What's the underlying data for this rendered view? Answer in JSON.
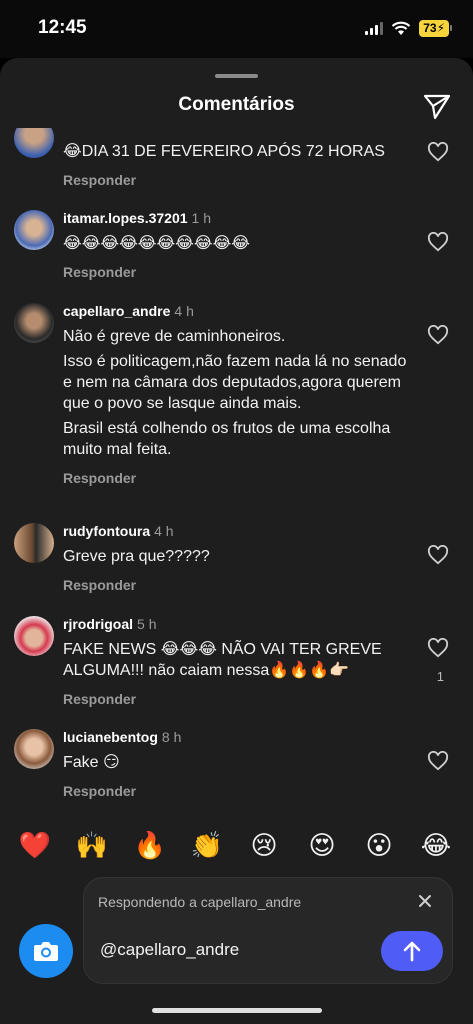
{
  "status_bar": {
    "time": "12:45",
    "battery": "73"
  },
  "sheet": {
    "title": "Comentários"
  },
  "reply_label": "Responder",
  "comments": [
    {
      "user": "",
      "time": "",
      "lines": [
        "😂DIA 31 DE FEVEREIRO APÓS 72 HORAS"
      ],
      "likes": ""
    },
    {
      "user": "itamar.lopes.37201",
      "time": "1 h",
      "lines": [
        "😂😂😂😂😂😂😂😂😂😂"
      ],
      "likes": ""
    },
    {
      "user": "capellaro_andre",
      "time": "4 h",
      "lines": [
        "Não é greve de caminhoneiros.",
        "Isso é politicagem,não fazem nada lá no senado e nem na câmara dos deputados,agora querem que o povo se lasque ainda mais.",
        "Brasil está colhendo os frutos de uma escolha muito mal feita."
      ],
      "likes": ""
    },
    {
      "user": "rudyfontoura",
      "time": "4 h",
      "lines": [
        "Greve pra que?????"
      ],
      "likes": ""
    },
    {
      "user": "rjrodrigoal",
      "time": "5 h",
      "lines": [
        "FAKE NEWS 😂😂😂 NÃO VAI TER GREVE ALGUMA!!! não caiam nessa🔥🔥🔥👉🏻"
      ],
      "likes": "1"
    },
    {
      "user": "lucianebentog",
      "time": "8 h",
      "lines": [
        "Fake 😏"
      ],
      "likes": ""
    }
  ],
  "emoji_bar": [
    "❤️",
    "🙌",
    "🔥",
    "👏",
    "😢",
    "😍",
    "😮",
    "😂"
  ],
  "composer": {
    "replying_to": "Respondendo a capellaro_andre",
    "input_value": "@capellaro_andre"
  },
  "icons": {
    "send": "paper-plane-icon",
    "like": "heart-outline-icon",
    "camera": "camera-icon",
    "close": "close-icon",
    "submit": "arrow-up-icon"
  },
  "colors": {
    "sheet_bg": "#1e1e1e",
    "accent": "#4f5cf6",
    "camera": "#1d8cf0",
    "battery": "#f5d33d"
  }
}
